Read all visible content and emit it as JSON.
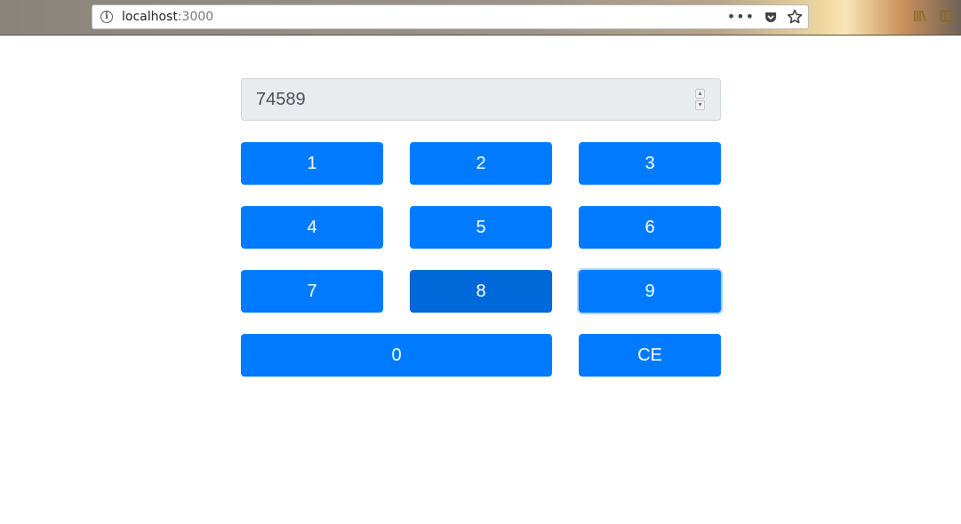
{
  "browser": {
    "url_host": "localhost",
    "url_port": ":3000",
    "icons": [
      "info-icon",
      "more-icon",
      "pocket-icon",
      "bookmark-star-icon",
      "library-icon",
      "sidebar-icon"
    ]
  },
  "calculator": {
    "display_value": "74589",
    "keys": [
      "1",
      "2",
      "3",
      "4",
      "5",
      "6",
      "7",
      "8",
      "9",
      "0",
      "CE"
    ],
    "pressed_key": "8",
    "focused_key": "9"
  },
  "colors": {
    "key_background": "#007bff",
    "key_pressed": "#0069d9",
    "display_background": "#e9ecef"
  }
}
